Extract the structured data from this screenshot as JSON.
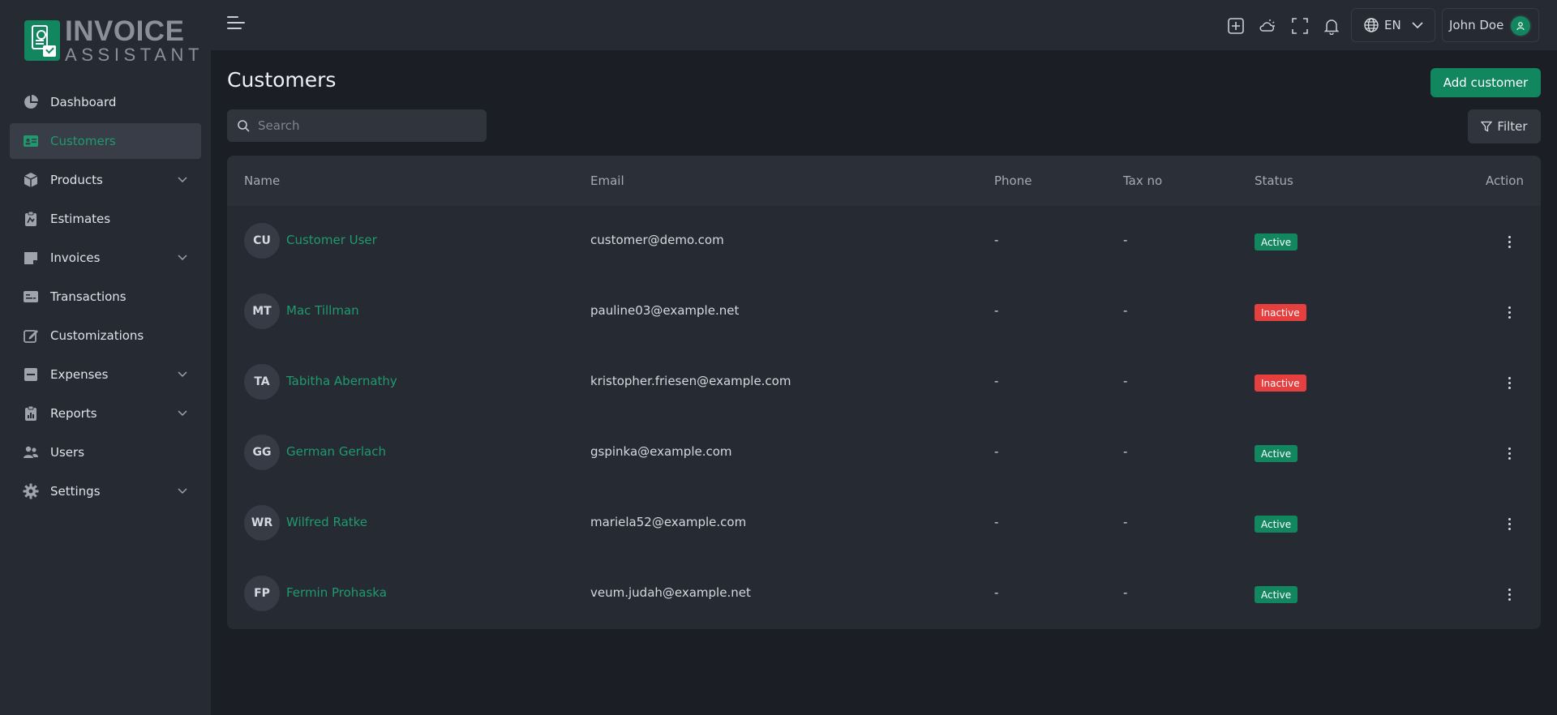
{
  "app": {
    "logo_line1": "INVOICE",
    "logo_line2": "ASSISTANT",
    "accent_color": "#12875f",
    "danger_color": "#e63f3f"
  },
  "sidebar": {
    "items": [
      {
        "label": "Dashboard",
        "icon": "pie-chart-icon",
        "active": false,
        "has_submenu": false
      },
      {
        "label": "Customers",
        "icon": "id-card-icon",
        "active": true,
        "has_submenu": false
      },
      {
        "label": "Products",
        "icon": "box-icon",
        "active": false,
        "has_submenu": true
      },
      {
        "label": "Estimates",
        "icon": "clipboard-icon",
        "active": false,
        "has_submenu": false
      },
      {
        "label": "Invoices",
        "icon": "invoice-icon",
        "active": false,
        "has_submenu": true
      },
      {
        "label": "Transactions",
        "icon": "transactions-icon",
        "active": false,
        "has_submenu": false
      },
      {
        "label": "Customizations",
        "icon": "edit-icon",
        "active": false,
        "has_submenu": false
      },
      {
        "label": "Expenses",
        "icon": "minus-square-icon",
        "active": false,
        "has_submenu": true
      },
      {
        "label": "Reports",
        "icon": "report-icon",
        "active": false,
        "has_submenu": true
      },
      {
        "label": "Users",
        "icon": "users-icon",
        "active": false,
        "has_submenu": false
      },
      {
        "label": "Settings",
        "icon": "gear-icon",
        "active": false,
        "has_submenu": true
      }
    ]
  },
  "topbar": {
    "language": "EN",
    "user_name": "John Doe"
  },
  "page": {
    "title": "Customers",
    "add_button": "Add customer",
    "search_placeholder": "Search",
    "filter_button": "Filter"
  },
  "table": {
    "columns": [
      "Name",
      "Email",
      "Phone",
      "Tax no",
      "Status",
      "Action"
    ],
    "rows": [
      {
        "initials": "CU",
        "name": "Customer User",
        "email": "customer@demo.com",
        "phone": "-",
        "tax": "-",
        "status": "Active"
      },
      {
        "initials": "MT",
        "name": "Mac Tillman",
        "email": "pauline03@example.net",
        "phone": "-",
        "tax": "-",
        "status": "Inactive"
      },
      {
        "initials": "TA",
        "name": "Tabitha Abernathy",
        "email": "kristopher.friesen@example.com",
        "phone": "-",
        "tax": "-",
        "status": "Inactive"
      },
      {
        "initials": "GG",
        "name": "German Gerlach",
        "email": "gspinka@example.com",
        "phone": "-",
        "tax": "-",
        "status": "Active"
      },
      {
        "initials": "WR",
        "name": "Wilfred Ratke",
        "email": "mariela52@example.com",
        "phone": "-",
        "tax": "-",
        "status": "Active"
      },
      {
        "initials": "FP",
        "name": "Fermin Prohaska",
        "email": "veum.judah@example.net",
        "phone": "-",
        "tax": "-",
        "status": "Active"
      }
    ]
  }
}
